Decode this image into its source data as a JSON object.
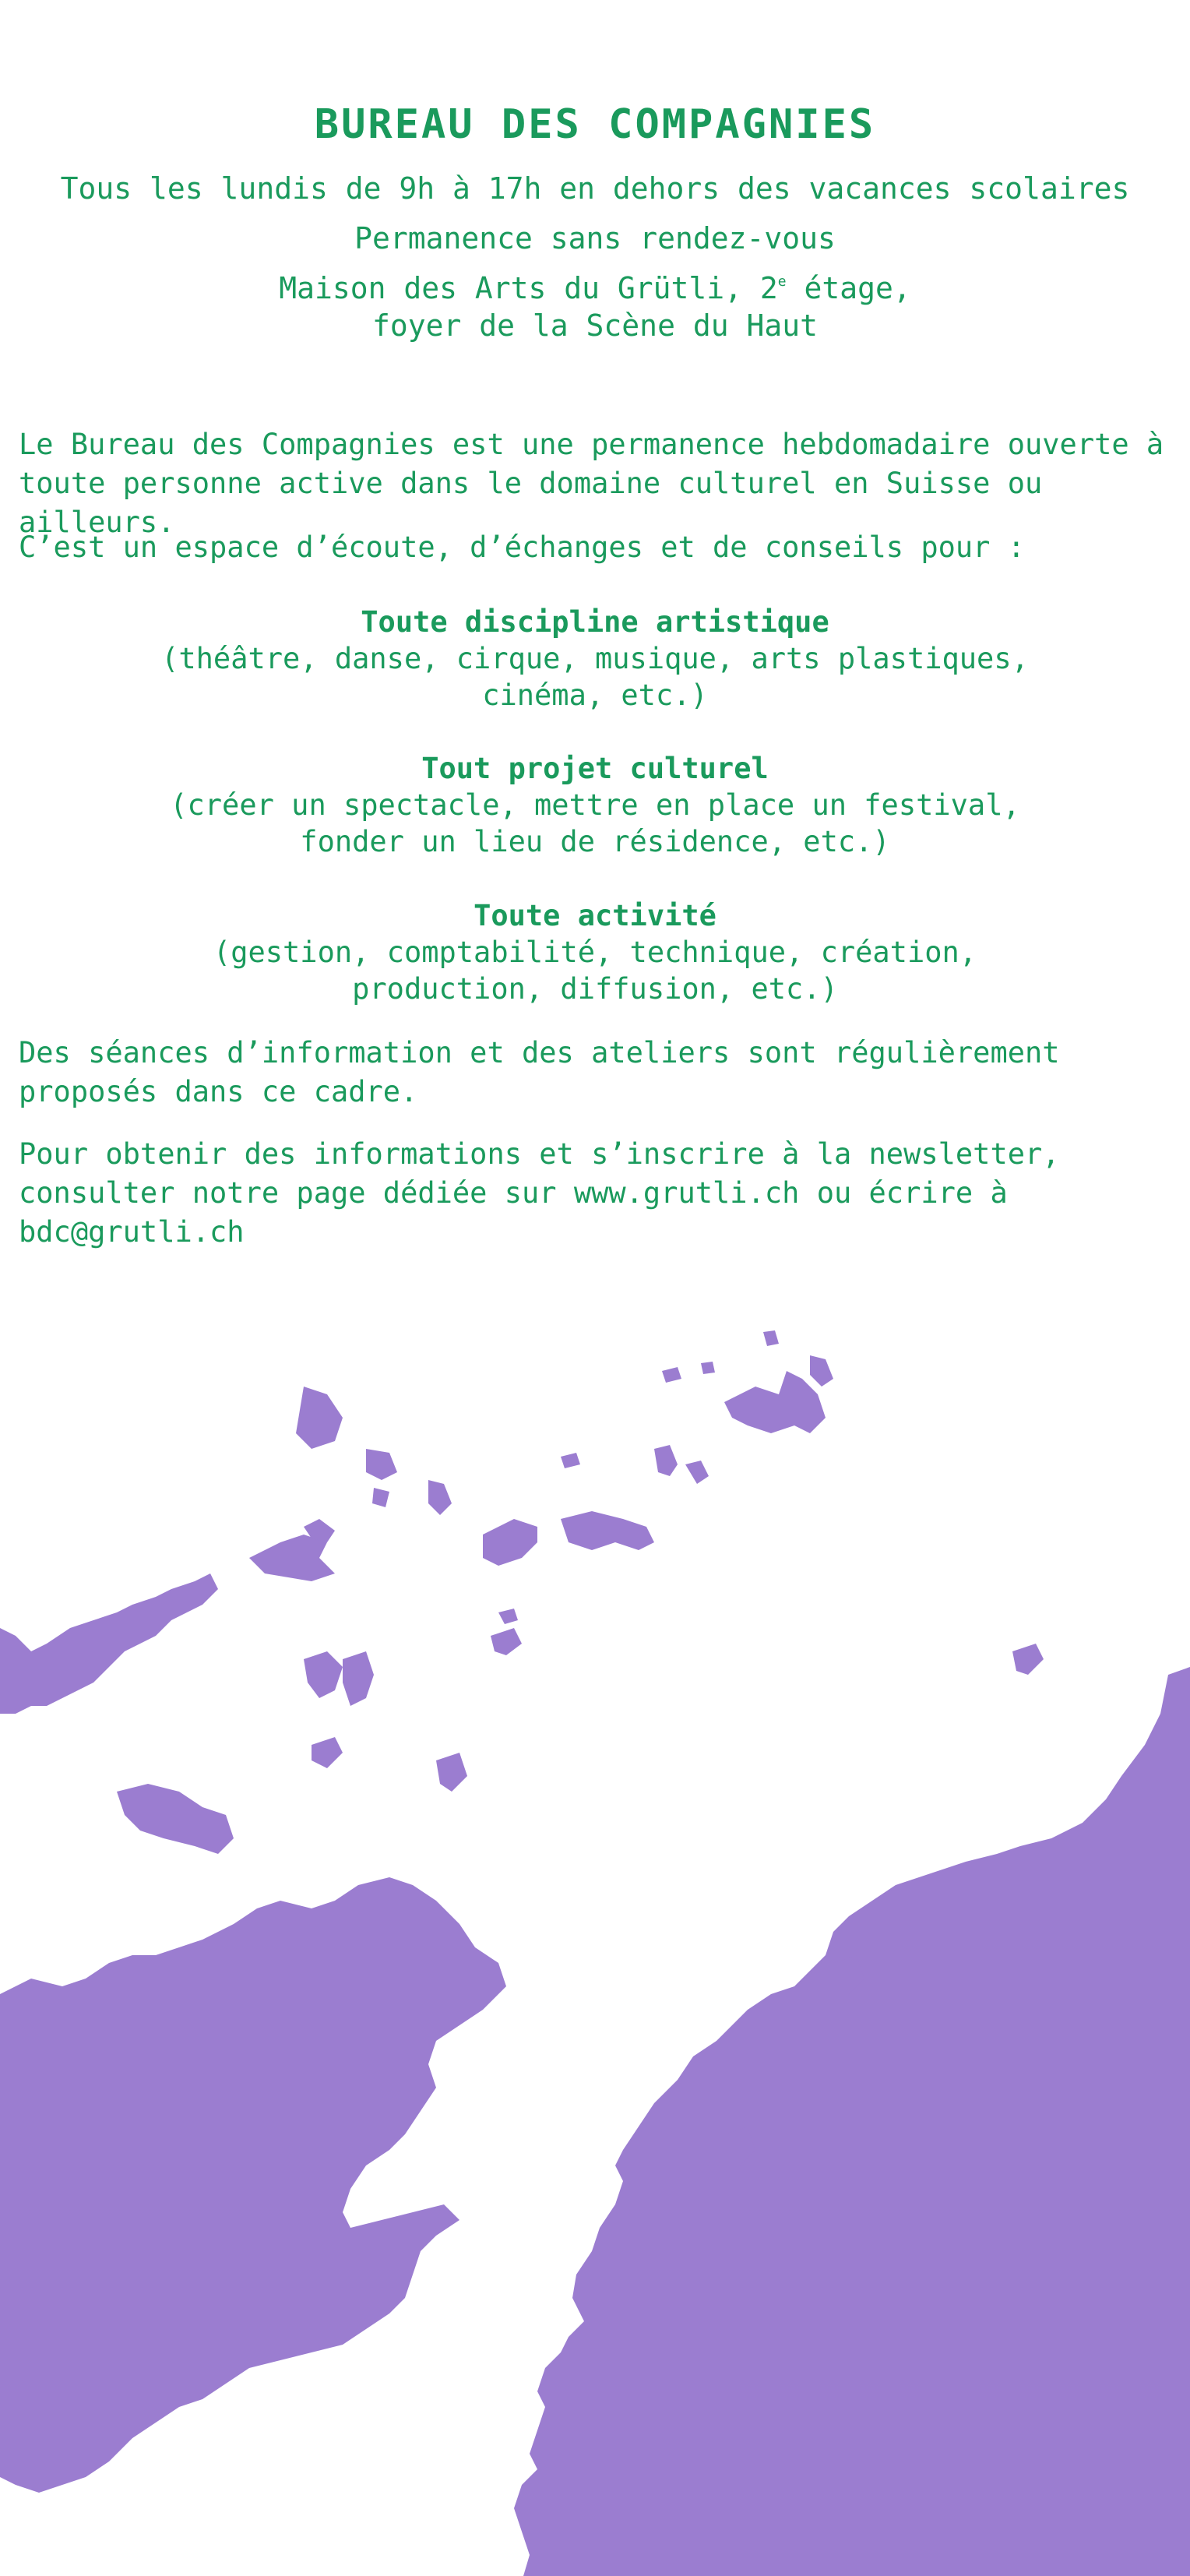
{
  "header": {
    "title": "BUREAU DES COMPAGNIES",
    "schedule": "Tous les lundis de 9h à 17h en dehors des vacances scolaires",
    "permanence": "Permanence sans rendez-vous",
    "location_part1": "Maison des Arts du Grütli, 2",
    "location_sup": "e",
    "location_part2": " étage,",
    "location_line2": "foyer de la Scène du Haut"
  },
  "intro": {
    "p1": "Le Bureau des Compagnies est une permanence hebdomadaire ouverte à toute personne active dans le domaine culturel en Suisse ou ailleurs.",
    "p2": "C’est un espace d’écoute, d’échanges et de conseils pour :"
  },
  "items": [
    {
      "heading": "Toute discipline artistique",
      "line1": "(théâtre, danse, cirque, musique, arts plastiques,",
      "line2": "cinéma, etc.)"
    },
    {
      "heading": "Tout projet culturel",
      "line1": "(créer un spectacle, mettre en place un festival,",
      "line2": "fonder un lieu de résidence, etc.)"
    },
    {
      "heading": "Toute activité",
      "line1": "(gestion, comptabilité, technique, création,",
      "line2": "production, diffusion, etc.)"
    }
  ],
  "outro": {
    "p3": "Des séances d’information et des ateliers sont régulièrement proposés dans ce cadre.",
    "p4": "Pour obtenir des informations et s’inscrire à la newsletter, consulter notre page dédiée sur www.grutli.ch ou écrire à bdc@grutli.ch"
  },
  "colors": {
    "text": "#1a9a5c",
    "map_fill": "#9b7dd0",
    "background": "#ffffff"
  }
}
